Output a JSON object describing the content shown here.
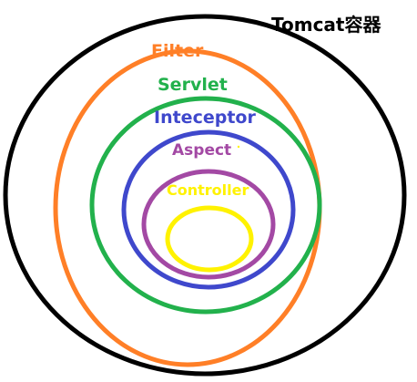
{
  "title": "Tomcat容器",
  "layers": [
    {
      "id": "tomcat",
      "label": "Tomcat容器",
      "color": "#000000"
    },
    {
      "id": "filter",
      "label": "Filter",
      "color": "#ff7f27"
    },
    {
      "id": "servlet",
      "label": "Servlet",
      "color": "#22b14c"
    },
    {
      "id": "interceptor",
      "label": "Inteceptor",
      "color": "#3f48cc"
    },
    {
      "id": "aspect",
      "label": "Aspect",
      "color": "#a349a4"
    },
    {
      "id": "controller",
      "label": "Controller",
      "color": "#fff200"
    }
  ]
}
